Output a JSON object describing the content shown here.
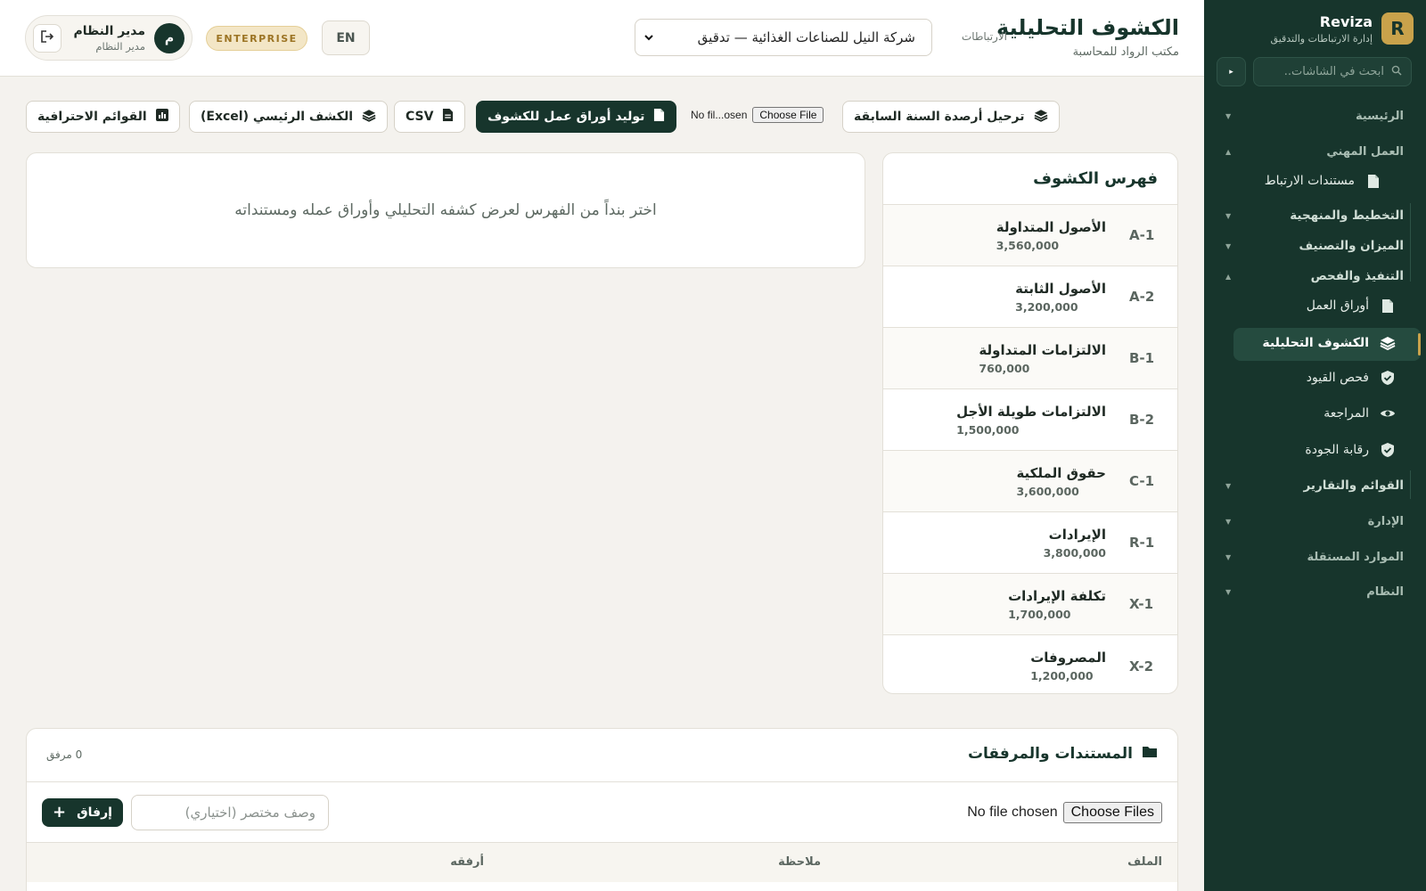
{
  "sidebar": {
    "brand_letter": "R",
    "brand_name": "Reviza",
    "brand_subtitle": "إدارة الارتباطات والتدقيق",
    "search_placeholder": "ابحث في الشاشات..",
    "groups": {
      "home": "الرئيسية",
      "professional": "العمل المهني",
      "planning": "التخطيط والمنهجية",
      "trial": "الميزان والتصنيف",
      "execution": "التنفيذ والفحص",
      "reports": "القوائم والتقارير",
      "admin": "الإدارة",
      "independent": "الموارد المستقلة",
      "system": "النظام"
    },
    "items": {
      "engagement_docs": "مستندات الارتباط",
      "working_papers": "أوراق العمل",
      "analytical": "الكشوف التحليلية",
      "entries_check": "فحص القيود",
      "review": "المراجعة",
      "quality": "رقابة الجودة"
    }
  },
  "header": {
    "title": "الكشوف التحليلية",
    "subtitle": "مكتب الرواد للمحاسبة",
    "engagements_label": "الارتباطات",
    "engagement_selected": "شركة النيل للصناعات الغذائية — تدقيق",
    "user_name": "مدير النظام",
    "user_role": "مدير النظام",
    "avatar_letter": "م",
    "plan_badge": "ENTERPRISE",
    "lang_button": "EN"
  },
  "toolbar": {
    "carry_forward": "ترحيل أرصدة السنة السابقة",
    "file_status": "No fil...osen",
    "choose_file": "Choose File",
    "generate": "توليد أوراق عمل للكشوف",
    "csv": "CSV",
    "main_excel": "الكشف الرئيسي (Excel)",
    "statements": "القوائم الاحترافية"
  },
  "index": {
    "title": "فهرس الكشوف",
    "rows": [
      {
        "code": "A-1",
        "name": "الأصول المتداولة",
        "amount": "3,560,000"
      },
      {
        "code": "A-2",
        "name": "الأصول الثابتة",
        "amount": "3,200,000"
      },
      {
        "code": "B-1",
        "name": "الالتزامات المتداولة",
        "amount": "760,000"
      },
      {
        "code": "B-2",
        "name": "الالتزامات طويلة الأجل",
        "amount": "1,500,000"
      },
      {
        "code": "C-1",
        "name": "حقوق الملكية",
        "amount": "3,600,000"
      },
      {
        "code": "R-1",
        "name": "الإيرادات",
        "amount": "3,800,000"
      },
      {
        "code": "X-1",
        "name": "تكلفة الإيرادات",
        "amount": "1,700,000"
      },
      {
        "code": "X-2",
        "name": "المصروفات",
        "amount": "1,200,000"
      }
    ]
  },
  "empty_state": "اختر بنداً من الفهرس لعرض كشفه التحليلي وأوراق عمله ومستنداته",
  "attachments": {
    "title": "المستندات والمرفقات",
    "count": "0 مرفق",
    "choose_files": "Choose Files",
    "file_status": "No file chosen",
    "description_placeholder": "وصف مختصر (اختياري)",
    "attach_button": "إرفاق",
    "columns": {
      "file": "الملف",
      "note": "ملاحظة",
      "attached_by": "أرفقه"
    }
  },
  "colors": {
    "sidebar_bg": "#17352c",
    "accent": "#c9a24b",
    "primary": "#17352c"
  }
}
